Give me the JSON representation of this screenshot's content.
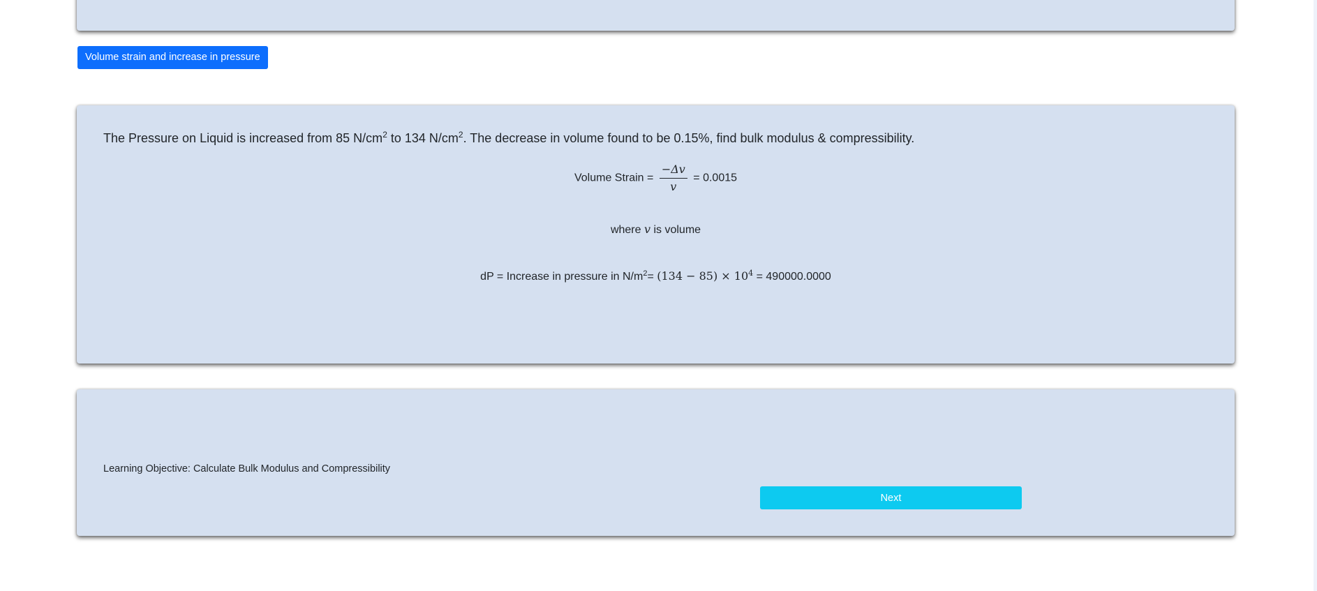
{
  "tab": {
    "label": "Volume strain and increase in pressure"
  },
  "problem": {
    "text_part1": "The Pressure on Liquid is increased from 85 N/cm",
    "sup1": "2",
    "text_part2": " to 134 N/cm",
    "sup2": "2",
    "text_part3": ". The decrease in volume found to be 0.15%, find bulk modulus & compressibility."
  },
  "strain": {
    "label": "Volume Strain =",
    "numerator": "−Δv",
    "denominator": "v",
    "result": "= 0.0015"
  },
  "where": {
    "prefix": "where",
    "var": "v",
    "suffix": "is volume"
  },
  "pressure": {
    "label": "dP = Increase in pressure in N/m",
    "label_sup": "2",
    "equals": "=",
    "expr": "(134 − 85) × 10",
    "expr_sup": "4",
    "result": "= 490000.0000"
  },
  "footer": {
    "objective": "Learning Objective: Calculate Bulk Modulus and Compressibility",
    "next_label": "Next"
  },
  "colors": {
    "card_bg": "#d5e0f0",
    "primary": "#0d6efd",
    "info": "#0dcaf0"
  }
}
